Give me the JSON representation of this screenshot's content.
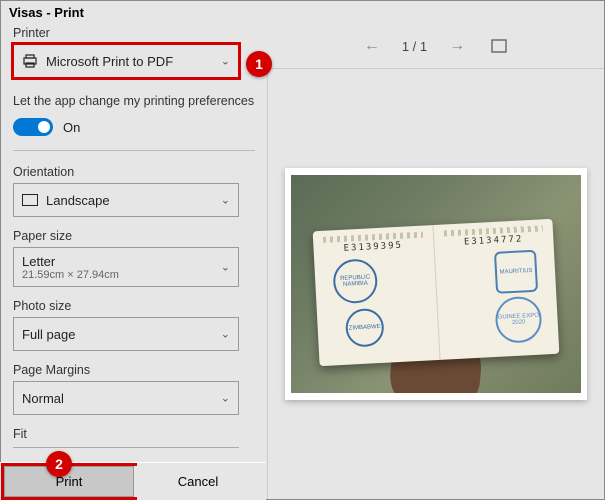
{
  "title": "Visas - Print",
  "sidebar": {
    "printer_label": "Printer",
    "printer_value": "Microsoft Print to PDF",
    "pref_label": "Let the app change my printing preferences",
    "toggle_state": "On",
    "orientation_label": "Orientation",
    "orientation_value": "Landscape",
    "papersize_label": "Paper size",
    "papersize_value": "Letter",
    "papersize_sub": "21.59cm × 27.94cm",
    "photosize_label": "Photo size",
    "photosize_value": "Full page",
    "margins_label": "Page Margins",
    "margins_value": "Normal",
    "fit_label": "Fit"
  },
  "preview": {
    "page_indicator": "1 / 1",
    "passport_num_l": "E3139395",
    "passport_num_r": "E3134772",
    "stamps": {
      "s1": "REPUBLIC NAMIBIA",
      "s2": "ZIMBABWE",
      "s3": "MAURITIUS",
      "s4": "GUINEE EXPO 2020"
    }
  },
  "actions": {
    "print": "Print",
    "cancel": "Cancel"
  },
  "annotations": {
    "badge1": "1",
    "badge2": "2"
  }
}
